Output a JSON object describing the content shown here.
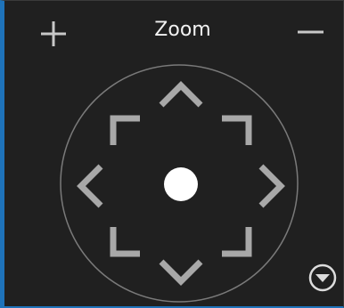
{
  "zoom": {
    "label": "Zoom",
    "in_icon": "plus-icon",
    "out_icon": "minus-icon"
  },
  "ptz": {
    "icons": {
      "up": "chevron-up-icon",
      "down": "chevron-down-icon",
      "left": "chevron-left-icon",
      "right": "chevron-right-icon",
      "up_left": "corner-up-left-icon",
      "up_right": "corner-up-right-icon",
      "down_left": "corner-down-left-icon",
      "down_right": "corner-down-right-icon",
      "center": "center-dot-icon"
    }
  },
  "expand": {
    "icon": "circle-chevron-down-icon"
  },
  "colors": {
    "background": "#202020",
    "accent": "#1e73ba",
    "arrow": "#a8a8a8",
    "ring": "#7a7a7a",
    "text": "#f2f2f2"
  }
}
